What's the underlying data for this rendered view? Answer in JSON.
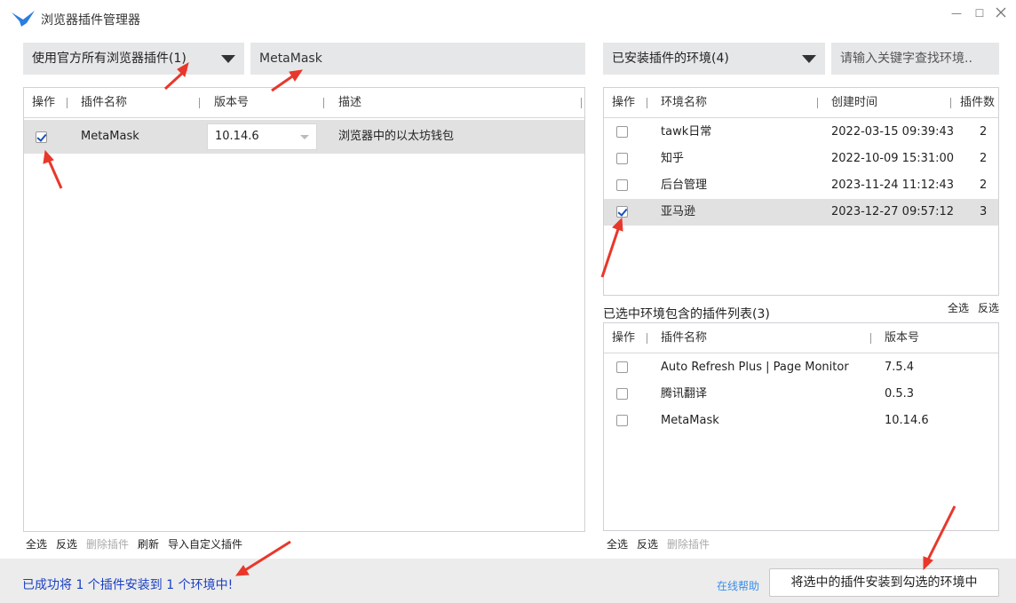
{
  "window": {
    "title": "浏览器插件管理器",
    "minimize": "—",
    "maximize": "☐"
  },
  "left": {
    "filter_label": "使用官方所有浏览器插件(1)",
    "search_value": "MetaMask",
    "headers": {
      "op": "操作",
      "name": "插件名称",
      "version": "版本号",
      "desc": "描述"
    },
    "rows": [
      {
        "checked": true,
        "name": "MetaMask",
        "version": "10.14.6",
        "desc": "浏览器中的以太坊钱包"
      }
    ],
    "actions": {
      "select_all": "全选",
      "invert": "反选",
      "delete": "删除插件",
      "refresh": "刷新",
      "import": "导入自定义插件"
    }
  },
  "right": {
    "env_filter_label": "已安装插件的环境(4)",
    "env_search_placeholder": "请输入关键字查找环境..",
    "env_headers": {
      "op": "操作",
      "name": "环境名称",
      "created": "创建时间",
      "count": "插件数"
    },
    "envs": [
      {
        "checked": false,
        "name": "tawk日常",
        "created": "2022-03-15 09:39:43",
        "count": "2"
      },
      {
        "checked": false,
        "name": "知乎",
        "created": "2022-10-09 15:31:00",
        "count": "2"
      },
      {
        "checked": false,
        "name": "后台管理",
        "created": "2023-11-24 11:12:43",
        "count": "2"
      },
      {
        "checked": true,
        "name": "亚马逊",
        "created": "2023-12-27 09:57:12",
        "count": "3"
      }
    ],
    "plugin_list_title": "已选中环境包含的插件列表(3)",
    "list_select_all": "全选",
    "list_invert": "反选",
    "plugin_headers": {
      "op": "操作",
      "name": "插件名称",
      "version": "版本号"
    },
    "plugins": [
      {
        "checked": false,
        "name": "Auto Refresh Plus | Page Monitor",
        "version": "7.5.4"
      },
      {
        "checked": false,
        "name": "腾讯翻译",
        "version": "0.5.3"
      },
      {
        "checked": false,
        "name": "MetaMask",
        "version": "10.14.6"
      }
    ],
    "actions": {
      "select_all": "全选",
      "invert": "反选",
      "delete": "删除插件"
    }
  },
  "status": {
    "message": "已成功将 1 个插件安装到 1 个环境中!",
    "help": "在线帮助",
    "install_button": "将选中的插件安装到勾选的环境中"
  },
  "colors": {
    "accent": "#1a3fc4",
    "link": "#3a8ee6",
    "arrow": "#e8382b",
    "selected_row": "#e1e1e1"
  }
}
